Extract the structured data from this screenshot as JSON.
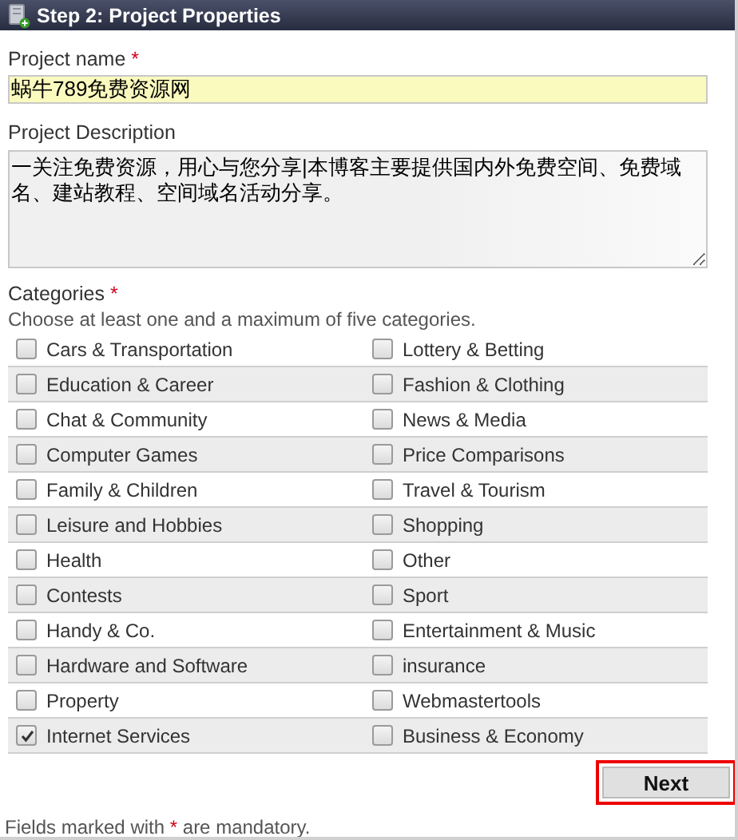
{
  "header": {
    "title": "Step 2: Project Properties"
  },
  "project_name": {
    "label": "Project name",
    "required_mark": "*",
    "value": "蜗牛789免费资源网"
  },
  "project_description": {
    "label": "Project Description",
    "value": "一关注免费资源，用心与您分享|本博客主要提供国内外免费空间、免费域名、建站教程、空间域名活动分享。"
  },
  "categories": {
    "label": "Categories",
    "required_mark": "*",
    "hint": "Choose at least one and a maximum of five categories.",
    "items": [
      {
        "label": "Cars & Transportation",
        "checked": false
      },
      {
        "label": "Lottery & Betting",
        "checked": false
      },
      {
        "label": "Education & Career",
        "checked": false
      },
      {
        "label": "Fashion & Clothing",
        "checked": false
      },
      {
        "label": "Chat & Community",
        "checked": false
      },
      {
        "label": "News & Media",
        "checked": false
      },
      {
        "label": "Computer Games",
        "checked": false
      },
      {
        "label": "Price Comparisons",
        "checked": false
      },
      {
        "label": "Family & Children",
        "checked": false
      },
      {
        "label": "Travel & Tourism",
        "checked": false
      },
      {
        "label": "Leisure and Hobbies",
        "checked": false
      },
      {
        "label": "Shopping",
        "checked": false
      },
      {
        "label": "Health",
        "checked": false
      },
      {
        "label": "Other",
        "checked": false
      },
      {
        "label": "Contests",
        "checked": false
      },
      {
        "label": "Sport",
        "checked": false
      },
      {
        "label": "Handy & Co.",
        "checked": false
      },
      {
        "label": "Entertainment & Music",
        "checked": false
      },
      {
        "label": "Hardware and Software",
        "checked": false
      },
      {
        "label": "insurance",
        "checked": false
      },
      {
        "label": "Property",
        "checked": false
      },
      {
        "label": "Webmastertools",
        "checked": false
      },
      {
        "label": "Internet Services",
        "checked": true
      },
      {
        "label": "Business & Economy",
        "checked": false
      }
    ]
  },
  "next_button": {
    "label": "Next",
    "highlighted": true
  },
  "footnote": {
    "before": "Fields marked with",
    "mark": "*",
    "after": "are mandatory."
  }
}
